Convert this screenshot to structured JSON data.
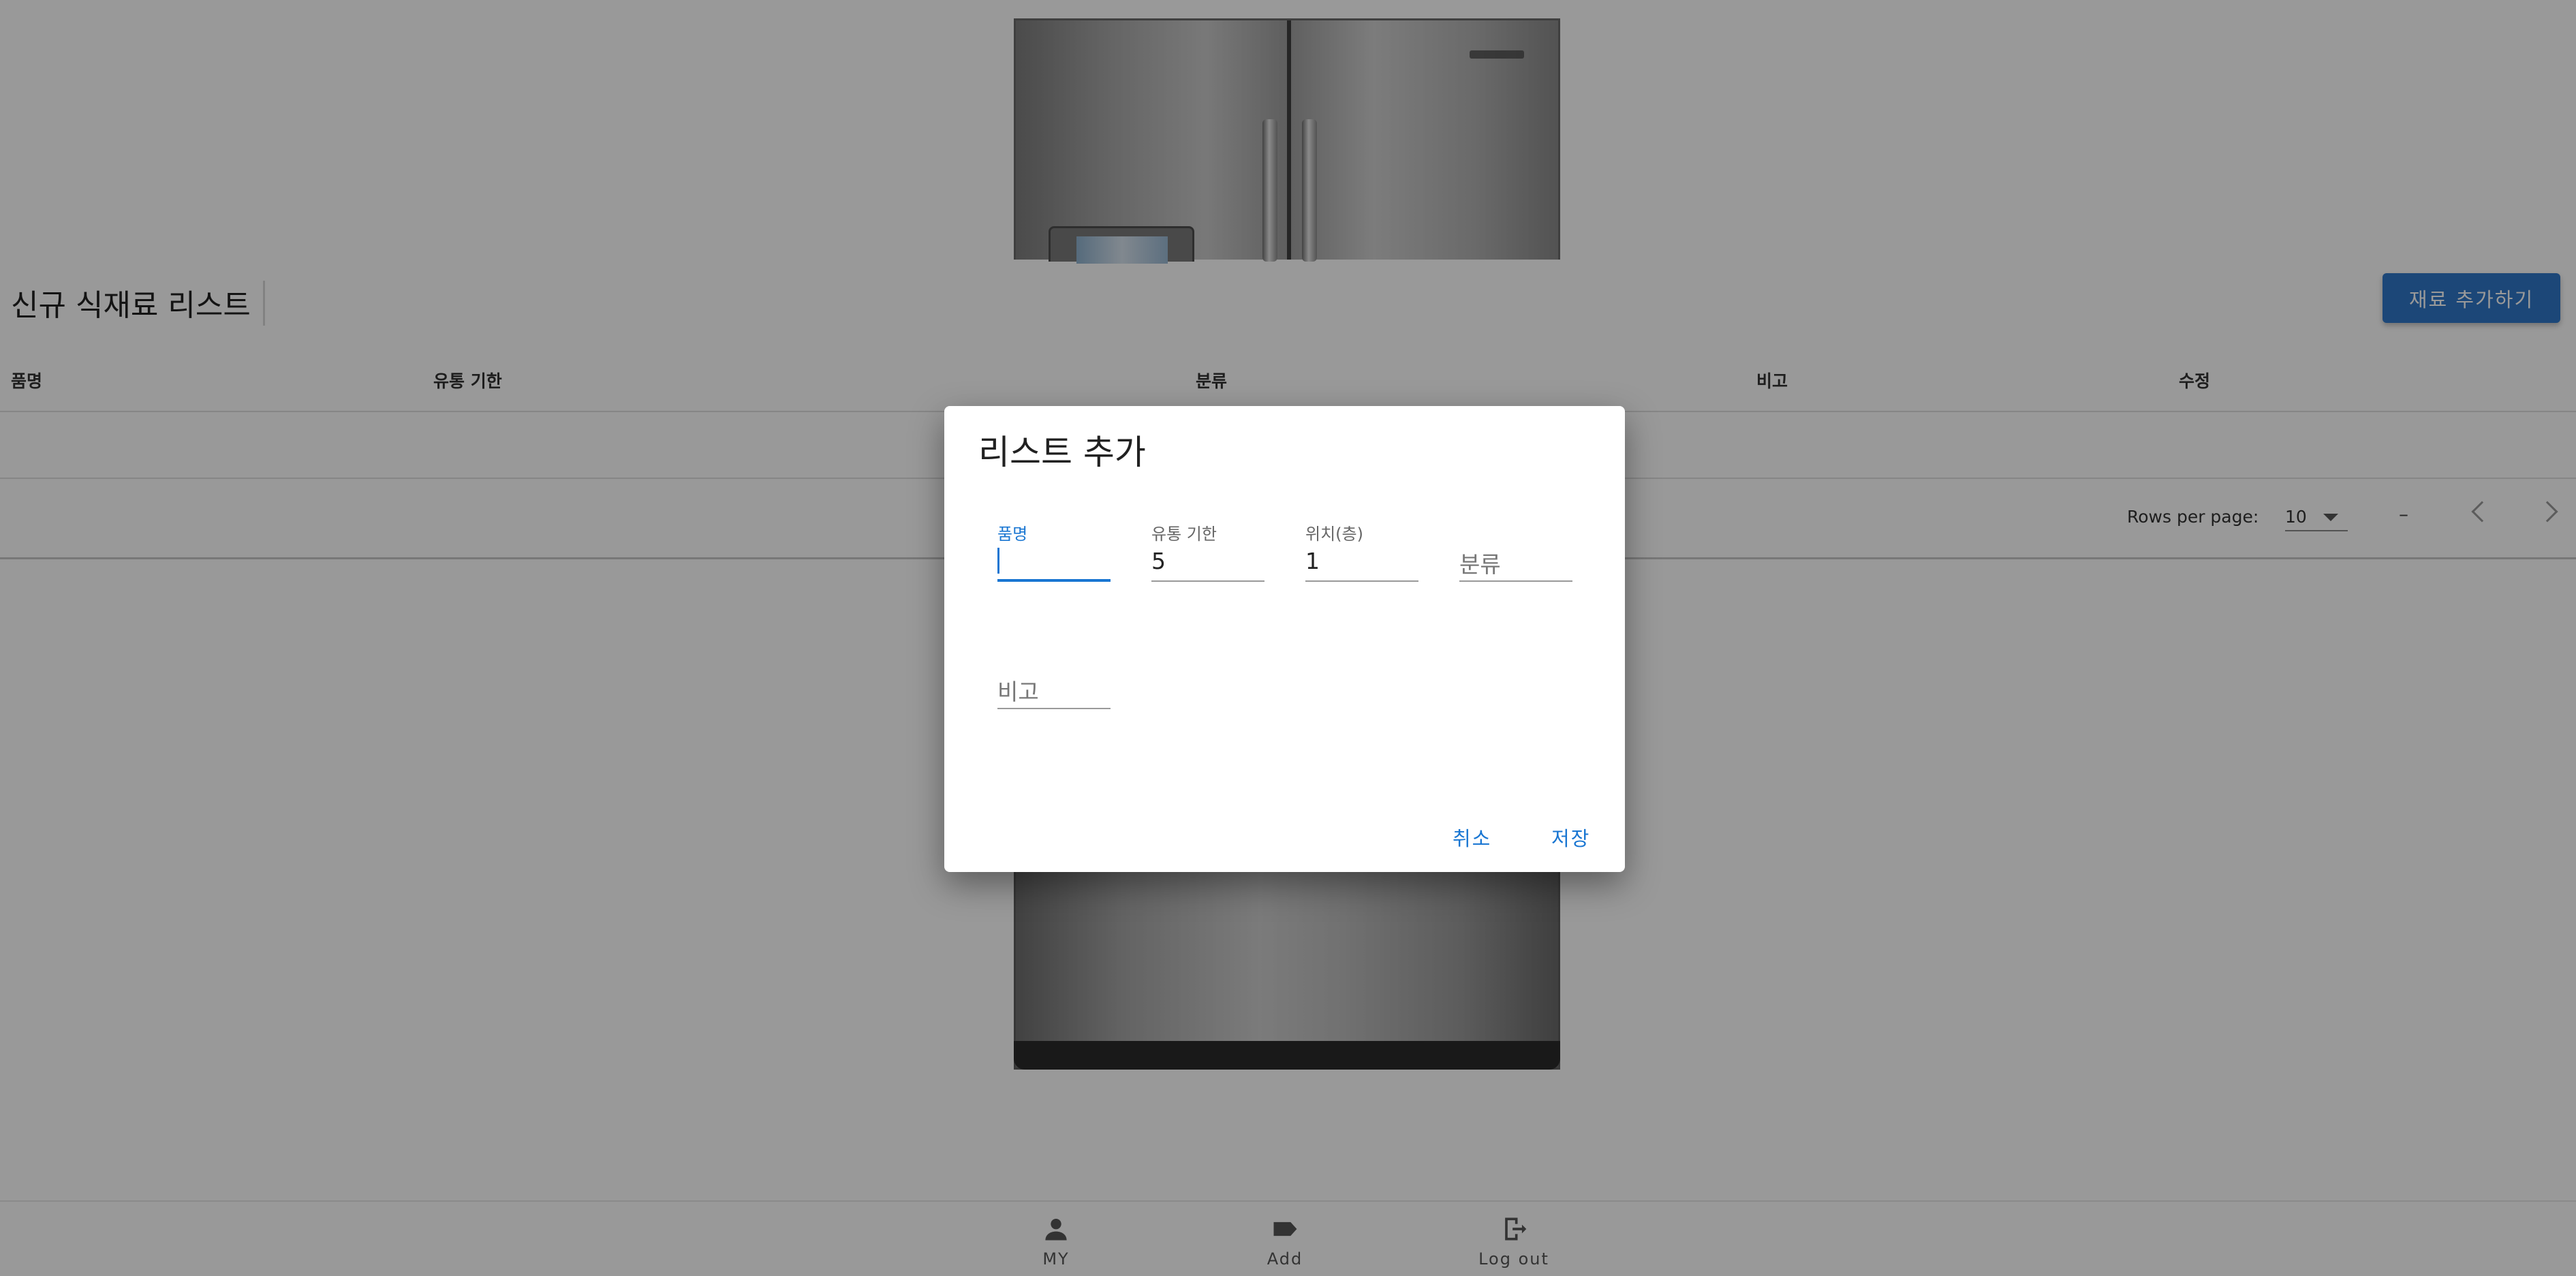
{
  "page": {
    "title": "신규 식재료 리스트",
    "add_button": "재료 추가하기"
  },
  "table": {
    "columns": [
      "품명",
      "유통 기한",
      "분류",
      "비고",
      "수정"
    ],
    "pagination": {
      "rows_label": "Rows per page:",
      "rows_value": "10",
      "range": "–"
    }
  },
  "nav": {
    "items": [
      {
        "label": "MY",
        "icon": "person-icon"
      },
      {
        "label": "Add",
        "icon": "label-icon"
      },
      {
        "label": "Log out",
        "icon": "logout-icon"
      }
    ]
  },
  "dialog": {
    "title": "리스트 추가",
    "fields": {
      "name": {
        "label": "품명",
        "value": ""
      },
      "expiry": {
        "label": "유통 기한",
        "value": "5"
      },
      "position": {
        "label": "위치(층)",
        "value": "1"
      },
      "category": {
        "placeholder": "분류"
      },
      "note": {
        "placeholder": "비고"
      }
    },
    "cancel": "취소",
    "save": "저장"
  },
  "colors": {
    "primary": "#1976d2",
    "button": "#2f77c9",
    "overlay": "rgba(0,0,0,0.4)"
  }
}
